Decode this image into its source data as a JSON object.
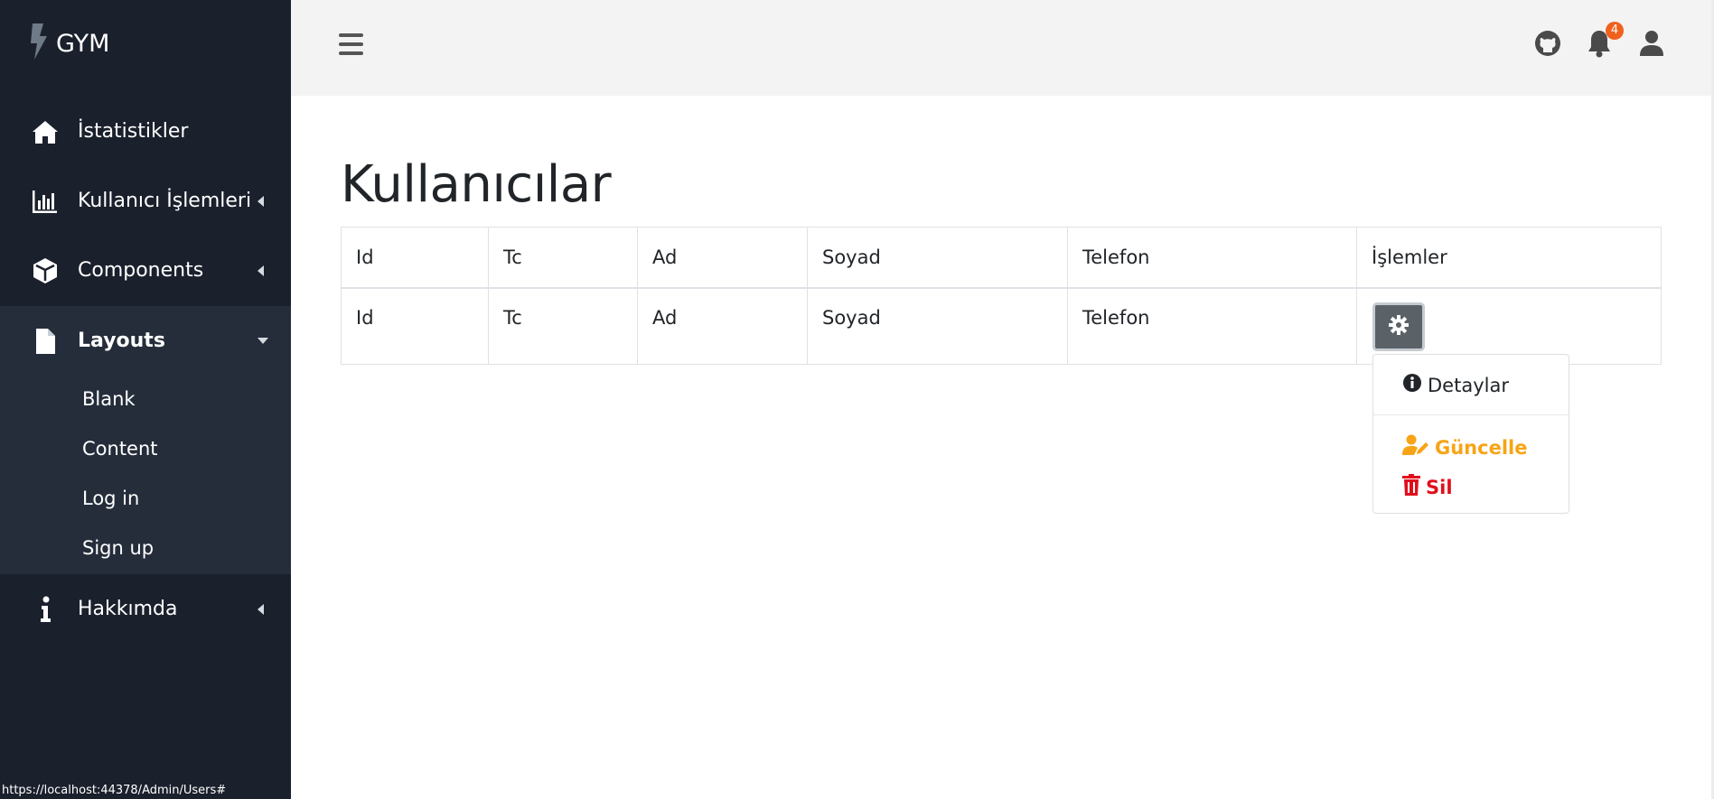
{
  "app": {
    "brand": "GYM"
  },
  "sidebar": {
    "items": [
      {
        "label": "İstatistikler",
        "icon": "home-icon"
      },
      {
        "label": "Kullanıcı İşlemleri",
        "icon": "chart-bar-icon"
      },
      {
        "label": "Components",
        "icon": "cube-icon"
      },
      {
        "label": "Layouts",
        "icon": "file-icon"
      },
      {
        "label": "Hakkımda",
        "icon": "info-icon"
      }
    ],
    "layouts_submenu": [
      "Blank",
      "Content",
      "Log in",
      "Sign up"
    ]
  },
  "topbar": {
    "notification_count": "4"
  },
  "main": {
    "title": "Kullanıcılar",
    "table": {
      "headers": [
        "Id",
        "Tc",
        "Ad",
        "Soyad",
        "Telefon",
        "İşlemler"
      ],
      "rows": [
        [
          "Id",
          "Tc",
          "Ad",
          "Soyad",
          "Telefon"
        ]
      ]
    },
    "actions_menu": {
      "details": "Detaylar",
      "update": "Güncelle",
      "delete": "Sil"
    }
  },
  "status_url": "https://localhost:44378/Admin/Users#",
  "colors": {
    "sidebar_bg": "#1a202c",
    "sidebar_active_bg": "#252d3b",
    "topbar_bg": "#f3f3f3",
    "warning": "#f7a416",
    "danger": "#e00f1c",
    "badge": "#f0611e",
    "gear_button": "#5a6268"
  }
}
